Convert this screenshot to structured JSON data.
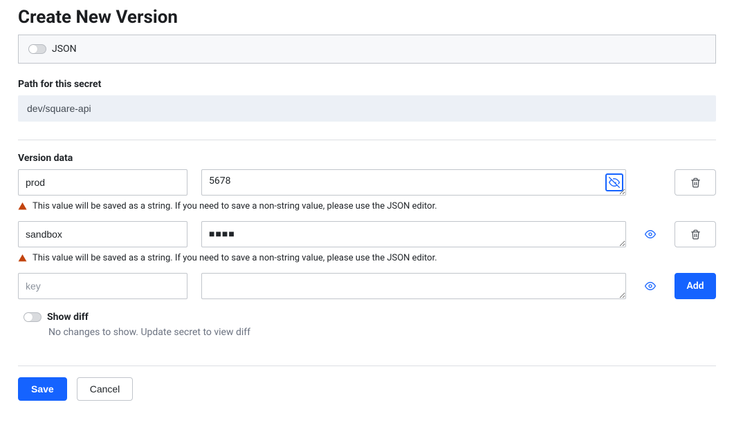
{
  "page": {
    "title": "Create New Version"
  },
  "json_toggle": {
    "label": "JSON",
    "on": false
  },
  "path": {
    "label": "Path for this secret",
    "value": "dev/square-api"
  },
  "version_data": {
    "label": "Version data",
    "rows": [
      {
        "key": "prod",
        "value": "5678",
        "masked": false,
        "warning": "This value will be saved as a string. If you need to save a non-string value, please use the JSON editor."
      },
      {
        "key": "sandbox",
        "value": "■■■■",
        "masked": true,
        "warning": "This value will be saved as a string. If you need to save a non-string value, please use the JSON editor."
      }
    ],
    "new_row": {
      "key_placeholder": "key",
      "value": ""
    },
    "add_label": "Add"
  },
  "diff": {
    "toggle_label": "Show diff",
    "hint": "No changes to show. Update secret to view diff",
    "on": false
  },
  "actions": {
    "save": "Save",
    "cancel": "Cancel"
  }
}
